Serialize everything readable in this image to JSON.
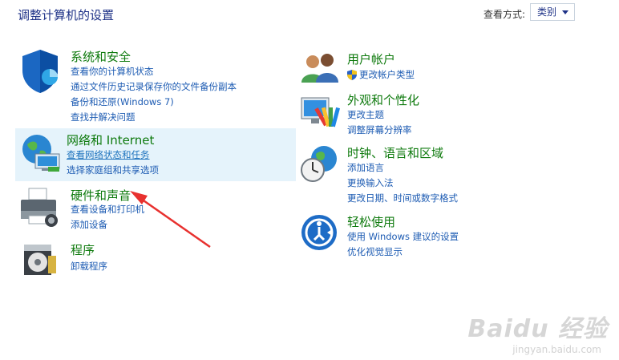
{
  "header": {
    "title": "调整计算机的设置",
    "view_by_label": "查看方式:",
    "view_by_value": "类别"
  },
  "left": [
    {
      "title": "系统和安全",
      "links": [
        "查看你的计算机状态",
        "通过文件历史记录保存你的文件备份副本",
        "备份和还原(Windows 7)",
        "查找并解决问题"
      ]
    },
    {
      "title": "网络和 Internet",
      "links": [
        "查看网络状态和任务",
        "选择家庭组和共享选项"
      ]
    },
    {
      "title": "硬件和声音",
      "links": [
        "查看设备和打印机",
        "添加设备"
      ]
    },
    {
      "title": "程序",
      "links": [
        "卸载程序"
      ]
    }
  ],
  "right": [
    {
      "title": "用户帐户",
      "links": [
        "更改帐户类型"
      ]
    },
    {
      "title": "外观和个性化",
      "links": [
        "更改主题",
        "调整屏幕分辨率"
      ]
    },
    {
      "title": "时钟、语言和区域",
      "links": [
        "添加语言",
        "更换输入法",
        "更改日期、时间或数字格式"
      ]
    },
    {
      "title": "轻松使用",
      "links": [
        "使用 Windows 建议的设置",
        "优化视觉显示"
      ]
    }
  ],
  "watermark": {
    "text": "Baidu 经验",
    "sub": "jingyan.baidu.com"
  },
  "colors": {
    "title": "#1e3287",
    "category": "#0e7a0d",
    "link": "#1e5cb3",
    "hover_bg": "#e5f3fb",
    "annotation": "#e8312f"
  },
  "icons": [
    "security-shield-icon",
    "network-globe-icon",
    "printer-icon",
    "programs-disc-icon",
    "users-icon",
    "monitor-palette-icon",
    "clock-globe-icon",
    "ease-of-access-icon",
    "uac-shield-icon"
  ]
}
